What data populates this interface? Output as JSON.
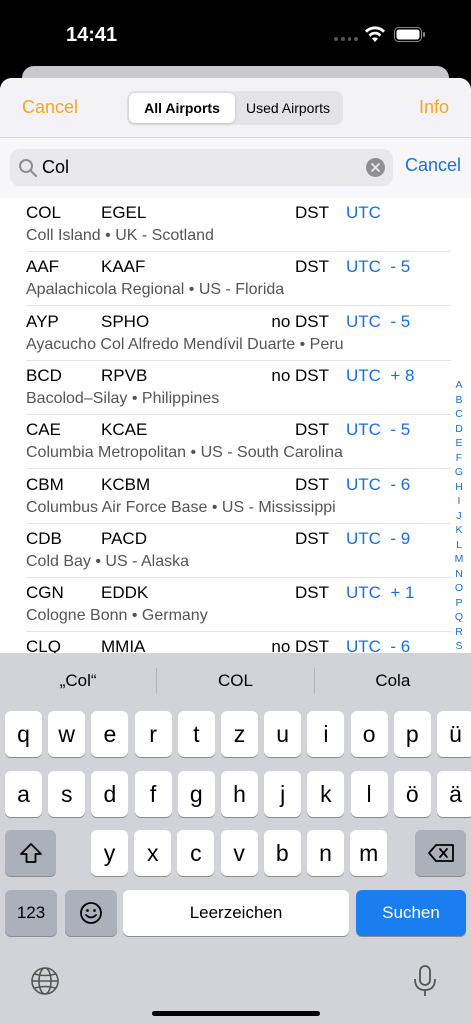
{
  "status": {
    "time": "14:41"
  },
  "nav": {
    "cancel": "Cancel",
    "info": "Info",
    "segments": [
      {
        "label": "All Airports",
        "active": true
      },
      {
        "label": "Used Airports",
        "active": false
      }
    ]
  },
  "search": {
    "value": "Col",
    "cancel": "Cancel"
  },
  "airports": [
    {
      "iata": "COL",
      "icao": "EGEL",
      "dst": "DST",
      "utc": "UTC",
      "desc": "Coll Island • UK - Scotland"
    },
    {
      "iata": "AAF",
      "icao": "KAAF",
      "dst": "DST",
      "utc": "UTC  - 5",
      "desc": "Apalachicola Regional • US - Florida"
    },
    {
      "iata": "AYP",
      "icao": "SPHO",
      "dst": "no DST",
      "utc": "UTC  - 5",
      "desc": "Ayacucho Col Alfredo Mendívil Duarte • Peru"
    },
    {
      "iata": "BCD",
      "icao": "RPVB",
      "dst": "no DST",
      "utc": "UTC  + 8",
      "desc": "Bacolod–Silay • Philippines"
    },
    {
      "iata": "CAE",
      "icao": "KCAE",
      "dst": "DST",
      "utc": "UTC  - 5",
      "desc": "Columbia Metropolitan • US - South Carolina"
    },
    {
      "iata": "CBM",
      "icao": "KCBM",
      "dst": "DST",
      "utc": "UTC  - 6",
      "desc": "Columbus Air Force Base • US - Mississippi"
    },
    {
      "iata": "CDB",
      "icao": "PACD",
      "dst": "DST",
      "utc": "UTC  - 9",
      "desc": "Cold Bay • US - Alaska"
    },
    {
      "iata": "CGN",
      "icao": "EDDK",
      "dst": "DST",
      "utc": "UTC  + 1",
      "desc": "Cologne Bonn • Germany"
    },
    {
      "iata": "CLQ",
      "icao": "MMIA",
      "dst": "no DST",
      "utc": "UTC  - 6",
      "desc": ""
    }
  ],
  "index_letters": [
    "A",
    "B",
    "C",
    "D",
    "E",
    "F",
    "G",
    "H",
    "I",
    "J",
    "K",
    "L",
    "M",
    "N",
    "O",
    "P",
    "Q",
    "R",
    "S"
  ],
  "keyboard": {
    "suggestions": [
      "„Col“",
      "COL",
      "Cola"
    ],
    "row1": [
      "q",
      "w",
      "e",
      "r",
      "t",
      "z",
      "u",
      "i",
      "o",
      "p",
      "ü"
    ],
    "row2": [
      "a",
      "s",
      "d",
      "f",
      "g",
      "h",
      "j",
      "k",
      "l",
      "ö",
      "ä"
    ],
    "row3": [
      "y",
      "x",
      "c",
      "v",
      "b",
      "n",
      "m"
    ],
    "numbers": "123",
    "space": "Leerzeichen",
    "submit": "Suchen"
  },
  "colors": {
    "accent_orange": "#f5a623",
    "accent_blue": "#1a6fe0"
  }
}
